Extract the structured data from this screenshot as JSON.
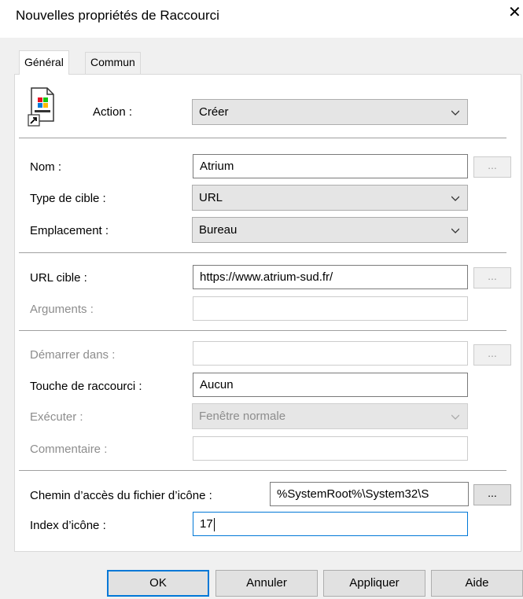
{
  "window": {
    "title": "Nouvelles propriétés de Raccourci",
    "close_glyph": "✕"
  },
  "tabs": [
    {
      "label": "Général",
      "active": true
    },
    {
      "label": "Commun",
      "active": false
    }
  ],
  "action": {
    "label": "Action :",
    "value": "Créer",
    "icon": "shortcut-file-icon"
  },
  "name": {
    "label": "Nom :",
    "value": "Atrium",
    "browse": "..."
  },
  "target_type": {
    "label": "Type de cible :",
    "value": "URL"
  },
  "location": {
    "label": "Emplacement :",
    "value": "Bureau"
  },
  "target_url": {
    "label": "URL cible :",
    "value": "https://www.atrium-sud.fr/",
    "browse": "..."
  },
  "arguments": {
    "label": "Arguments :",
    "value": ""
  },
  "start_in": {
    "label": "Démarrer dans :",
    "value": "",
    "browse": "..."
  },
  "hotkey": {
    "label": "Touche de raccourci :",
    "value": "Aucun"
  },
  "run": {
    "label": "Exécuter :",
    "value": "Fenêtre normale"
  },
  "comment": {
    "label": "Commentaire :",
    "value": ""
  },
  "icon_path": {
    "label": "Chemin d’accès du fichier d’icône :",
    "value": "%SystemRoot%\\System32\\S",
    "browse": "..."
  },
  "icon_index": {
    "label": "Index d’icône :",
    "value": "17"
  },
  "buttons": {
    "ok": "OK",
    "cancel": "Annuler",
    "apply": "Appliquer",
    "help": "Aide"
  },
  "colors": {
    "focus_blue": "#0078d7",
    "dialog_bg": "#f0f0f0",
    "disabled_text": "#8d8d8d"
  }
}
